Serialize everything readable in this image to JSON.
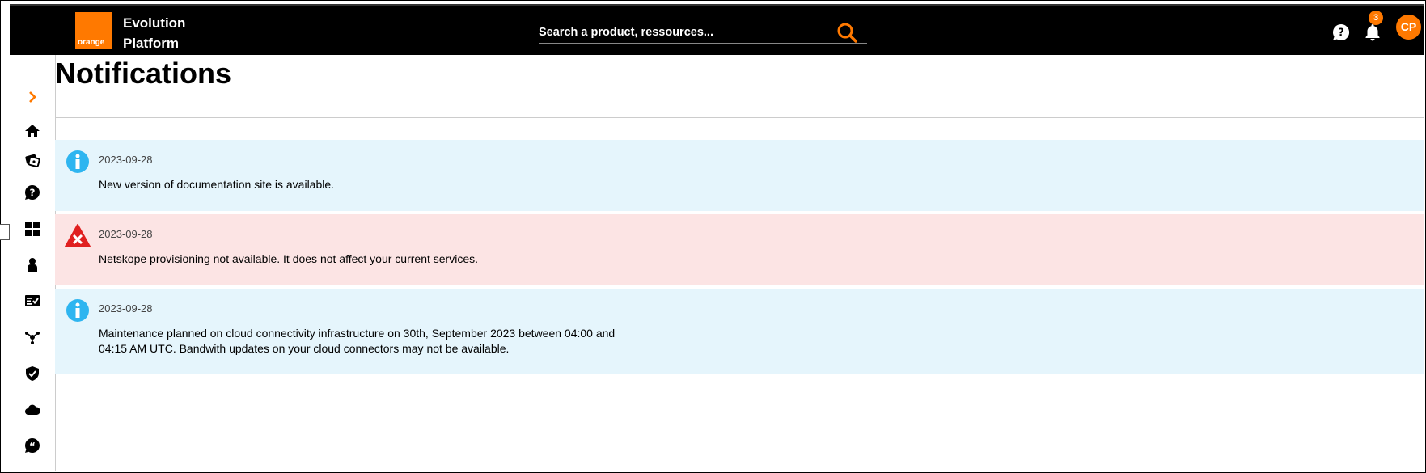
{
  "header": {
    "logo_text": "orange",
    "brand_line1": "Evolution",
    "brand_line2": "Platform",
    "search_placeholder": "Search a product, ressources...",
    "notification_count": "3",
    "avatar_initials": "CP",
    "accent_color": "#ff7900"
  },
  "sidebar": {
    "items": [
      {
        "icon": "chevron-right-icon"
      },
      {
        "icon": "home-icon"
      },
      {
        "icon": "tickets-icon"
      },
      {
        "icon": "help-icon"
      },
      {
        "icon": "dashboard-grid-icon"
      },
      {
        "icon": "user-icon"
      },
      {
        "icon": "checklist-card-icon"
      },
      {
        "icon": "network-icon"
      },
      {
        "icon": "shield-icon"
      },
      {
        "icon": "cloud-icon"
      },
      {
        "icon": "chat-quote-icon"
      }
    ]
  },
  "page": {
    "title": "Notifications"
  },
  "notifications": [
    {
      "type": "info",
      "date": "2023-09-28",
      "message": "New version of documentation site is available."
    },
    {
      "type": "error",
      "date": "2023-09-28",
      "message": "Netskope provisioning not available. It does not affect your current services."
    },
    {
      "type": "info",
      "date": "2023-09-28",
      "message": "Maintenance planned on cloud connectivity infrastructure on 30th, September 2023 between 04:00 and 04:15 AM UTC. Bandwith updates on your cloud connectors may not be available."
    }
  ],
  "colors": {
    "info_bg": "#e5f5fc",
    "error_bg": "#fce4e4",
    "info_icon": "#2eb5f0",
    "error_icon": "#e02020"
  }
}
